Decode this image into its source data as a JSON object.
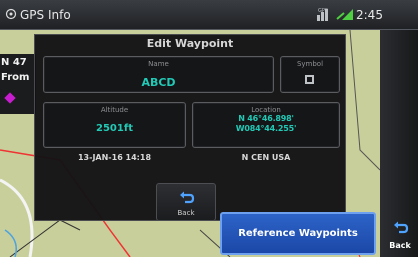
{
  "statusbar": {
    "title": "GPS Info",
    "time": "2:45",
    "icons": [
      "gps-icon",
      "satellite-icon",
      "signal-icon"
    ]
  },
  "map_peek": {
    "line1": "N 47",
    "line2": "From"
  },
  "dialog": {
    "title": "Edit Waypoint",
    "name": {
      "label": "Name",
      "value": "ABCD"
    },
    "symbol": {
      "label": "Symbol",
      "icon": "waypoint-square-icon"
    },
    "altitude": {
      "label": "Altitude",
      "value": "2501ft"
    },
    "location": {
      "label": "Location",
      "line1": "N  46°46.898'",
      "line2": "W084°44.255'"
    },
    "timestamp": "13-JAN-16 14:18",
    "region": "N CEN USA",
    "back_label": "Back"
  },
  "buttons": {
    "reference_waypoints": "Reference Waypoints",
    "back": "Back"
  },
  "colors": {
    "accent_teal": "#22c9b6",
    "button_blue": "#2558bb",
    "map_background": "#c9cf9a"
  }
}
